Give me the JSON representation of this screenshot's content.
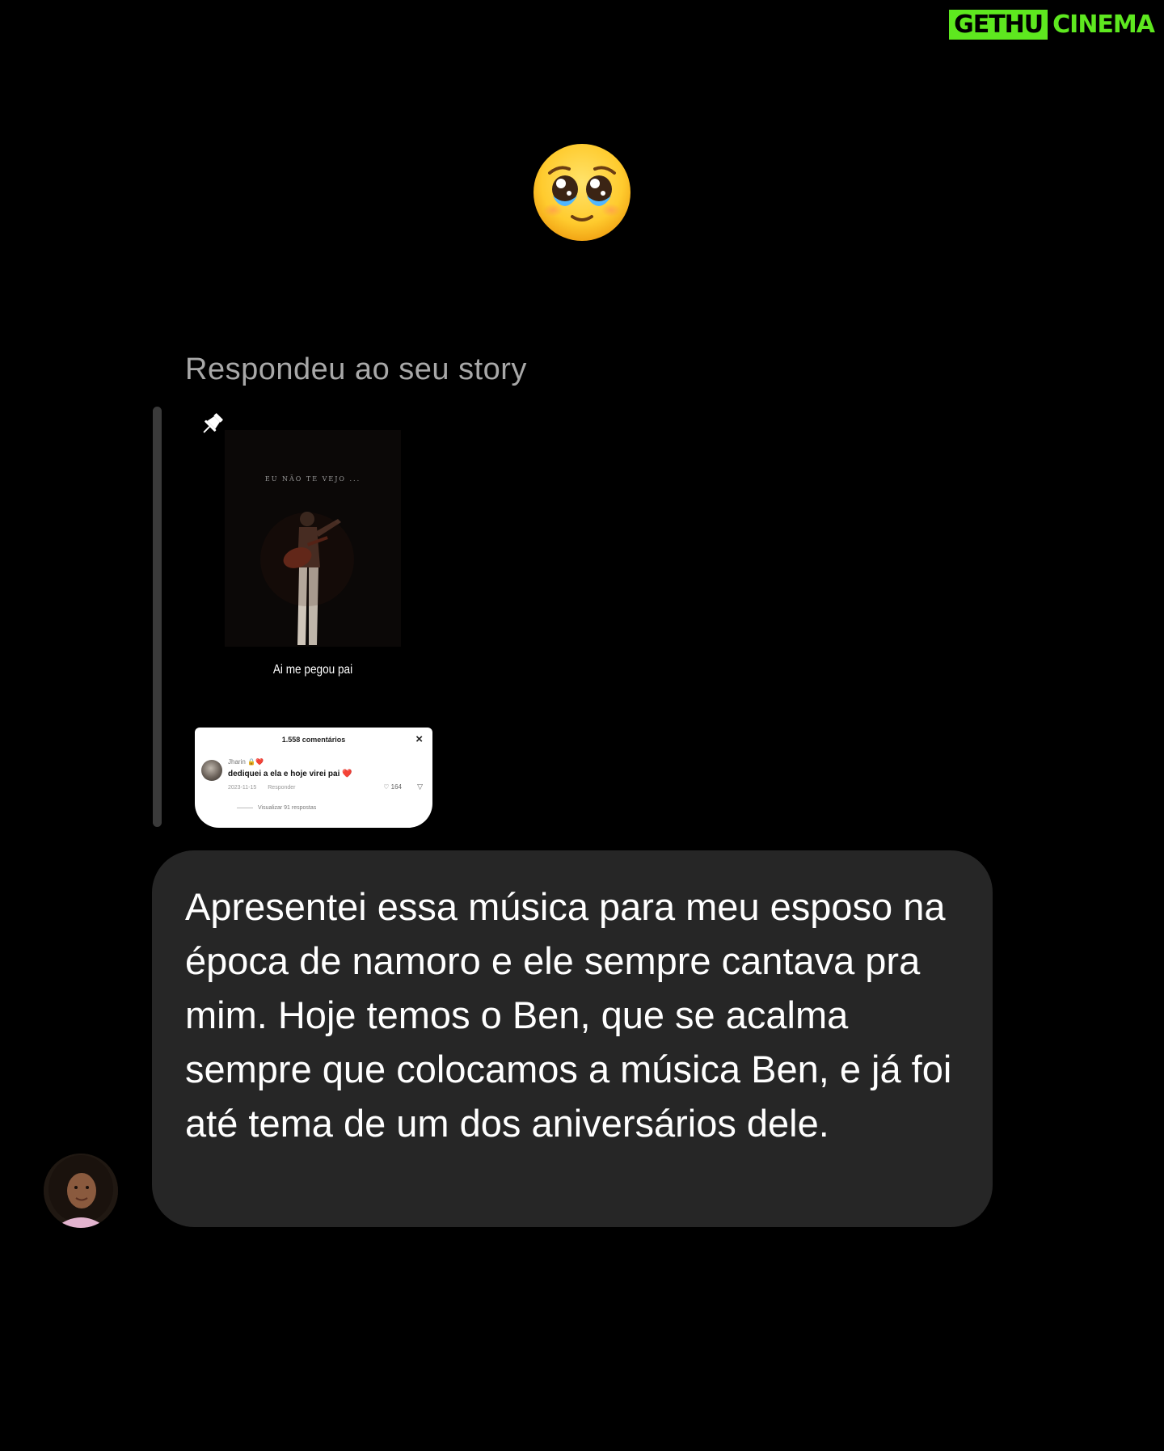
{
  "watermark": {
    "left": "GETHU",
    "right": "CINEMA",
    "colors": {
      "green": "#5ee81f"
    }
  },
  "reaction": {
    "emoji_name": "pleading-face-with-tears-emoji"
  },
  "story_reply": {
    "label": "Respondeu ao seu story",
    "story_thumb_title": "EU NÃO TE VEJO ...",
    "story_caption": "Ai me pegou pai",
    "comment_card": {
      "header": "1.558 comentários",
      "close_icon": "×",
      "user": "Jharin 🔒❤️",
      "text": "dediquei a ela e hoje virei pai ❤️",
      "date": "2023-11-15",
      "reply_label": "Responder",
      "likes": "164",
      "view_replies": "Visualizar 91 respostas"
    }
  },
  "message": {
    "text": "Apresentei essa música para meu esposo na época de namoro e ele sempre cantava pra mim. Hoje temos o Ben, que se acalma sempre que colocamos a música Ben, e já foi até tema de um dos aniversários dele."
  },
  "colors": {
    "background": "#000000",
    "bubble": "#262626",
    "muted_text": "#a8a8a8",
    "reply_bar": "#3a3a3a"
  }
}
